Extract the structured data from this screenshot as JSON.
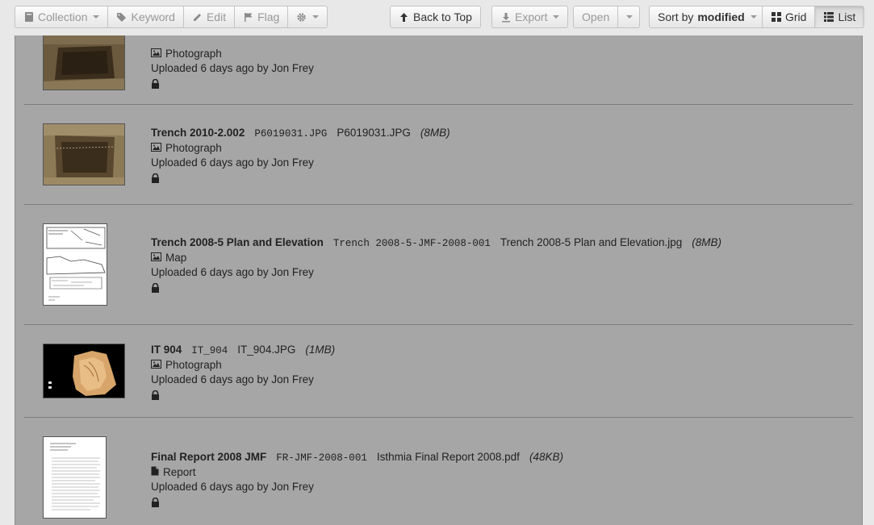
{
  "toolbar": {
    "collection": "Collection",
    "keyword": "Keyword",
    "edit": "Edit",
    "flag": "Flag",
    "back_to_top": "Back to Top",
    "export": "Export",
    "open": "Open",
    "sort_prefix": "Sort by",
    "sort_value": "modified",
    "grid": "Grid",
    "list": "List"
  },
  "items": [
    {
      "title": "",
      "id": "",
      "filename": "",
      "size": "",
      "type": "Photograph",
      "uploaded": "Uploaded 6 days ago by Jon Frey"
    },
    {
      "title": "Trench 2010-2.002",
      "id": "P6019031.JPG",
      "filename": "P6019031.JPG",
      "size": "(8MB)",
      "type": "Photograph",
      "uploaded": "Uploaded 6 days ago by Jon Frey"
    },
    {
      "title": "Trench 2008-5 Plan and Elevation",
      "id": "Trench 2008-5-JMF-2008-001",
      "filename": "Trench 2008-5 Plan and Elevation.jpg",
      "size": "(8MB)",
      "type": "Map",
      "uploaded": "Uploaded 6 days ago by Jon Frey"
    },
    {
      "title": "IT 904",
      "id": "IT_904",
      "filename": "IT_904.JPG",
      "size": "(1MB)",
      "type": "Photograph",
      "uploaded": "Uploaded 6 days ago by Jon Frey"
    },
    {
      "title": "Final Report 2008 JMF",
      "id": "FR-JMF-2008-001",
      "filename": "Isthmia Final Report 2008.pdf",
      "size": "(48KB)",
      "type": "Report",
      "uploaded": "Uploaded 6 days ago by Jon Frey"
    }
  ],
  "icons": {
    "photo": "photo-icon",
    "report": "document-icon",
    "lock": "lock-icon"
  }
}
